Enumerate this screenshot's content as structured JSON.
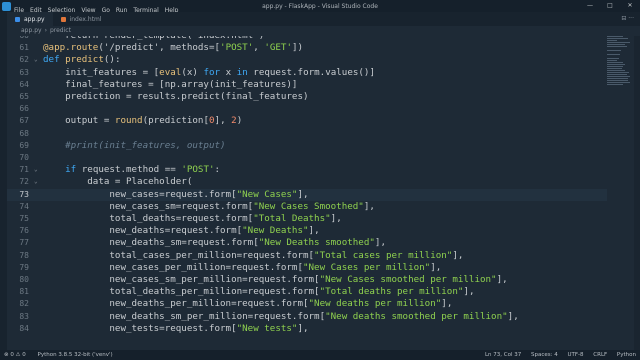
{
  "titlebar": {
    "menu": [
      "File",
      "Edit",
      "Selection",
      "View",
      "Go",
      "Run",
      "Terminal",
      "Help"
    ],
    "title": "app.py - FlaskApp - Visual Studio Code",
    "min": "—",
    "max": "□",
    "close": "✕"
  },
  "tabs": [
    {
      "label": "app.py",
      "color": "#3b8eea"
    },
    {
      "label": "index.html",
      "color": "#e0763a"
    }
  ],
  "tab_actions": "⊟ ···",
  "breadcrumb": {
    "file": "app.py",
    "symbol": "predict"
  },
  "code": {
    "lines": [
      {
        "n": "60",
        "tokens": [
          [
            "    return render_template('index.html')",
            ""
          ]
        ]
      },
      {
        "n": "61",
        "tokens": [
          [
            "@app.route",
            "dec"
          ],
          [
            "('/predict', methods=[",
            ""
          ],
          [
            "'POST'",
            "str"
          ],
          [
            ", ",
            ""
          ],
          [
            "'GET'",
            "str"
          ],
          [
            "])",
            ""
          ]
        ]
      },
      {
        "n": "62",
        "tokens": [
          [
            "def ",
            "kw"
          ],
          [
            "predict",
            "fn"
          ],
          [
            "():",
            ""
          ]
        ]
      },
      {
        "n": "63",
        "tokens": [
          [
            "    init_features = [",
            ""
          ],
          [
            "eval",
            "fn"
          ],
          [
            "(x) ",
            ""
          ],
          [
            "for",
            "kw"
          ],
          [
            " x ",
            ""
          ],
          [
            "in",
            "kw"
          ],
          [
            " request.form.values()]",
            ""
          ]
        ]
      },
      {
        "n": "64",
        "tokens": [
          [
            "    final_features = [np.array(init_features)]",
            ""
          ]
        ]
      },
      {
        "n": "65",
        "tokens": [
          [
            "    prediction = results.predict(final_features)",
            ""
          ]
        ]
      },
      {
        "n": "66",
        "tokens": [
          [
            "",
            ""
          ]
        ]
      },
      {
        "n": "67",
        "tokens": [
          [
            "    output = ",
            ""
          ],
          [
            "round",
            "fn"
          ],
          [
            "(prediction[",
            ""
          ],
          [
            "0",
            "num"
          ],
          [
            "], ",
            ""
          ],
          [
            "2",
            "num"
          ],
          [
            ")",
            ""
          ]
        ]
      },
      {
        "n": "68",
        "tokens": [
          [
            "",
            ""
          ]
        ]
      },
      {
        "n": "69",
        "tokens": [
          [
            "    #print(init_features, output)",
            "cm"
          ]
        ]
      },
      {
        "n": "70",
        "tokens": [
          [
            "",
            ""
          ]
        ]
      },
      {
        "n": "71",
        "tokens": [
          [
            "    ",
            ""
          ],
          [
            "if",
            "kw"
          ],
          [
            " request.method == ",
            ""
          ],
          [
            "'POST'",
            "str"
          ],
          [
            ":",
            ""
          ]
        ]
      },
      {
        "n": "72",
        "tokens": [
          [
            "        data = Placeholder(",
            ""
          ]
        ]
      },
      {
        "n": "73",
        "tokens": [
          [
            "            new_cases=request.form[",
            ""
          ],
          [
            "\"New Cases\"",
            "str"
          ],
          [
            "],",
            ""
          ]
        ]
      },
      {
        "n": "74",
        "tokens": [
          [
            "            new_cases_sm=request.form[",
            ""
          ],
          [
            "\"New Cases Smoothed\"",
            "str"
          ],
          [
            "],",
            ""
          ]
        ]
      },
      {
        "n": "75",
        "tokens": [
          [
            "            total_deaths=request.form[",
            ""
          ],
          [
            "\"Total Deaths\"",
            "str"
          ],
          [
            "],",
            ""
          ]
        ]
      },
      {
        "n": "76",
        "tokens": [
          [
            "            new_deaths=request.form[",
            ""
          ],
          [
            "\"New Deaths\"",
            "str"
          ],
          [
            "],",
            ""
          ]
        ]
      },
      {
        "n": "77",
        "tokens": [
          [
            "            new_deaths_sm=request.form[",
            ""
          ],
          [
            "\"New Deaths smoothed\"",
            "str"
          ],
          [
            "],",
            ""
          ]
        ]
      },
      {
        "n": "78",
        "tokens": [
          [
            "            total_cases_per_million=request.form[",
            ""
          ],
          [
            "\"Total cases per million\"",
            "str"
          ],
          [
            "],",
            ""
          ]
        ]
      },
      {
        "n": "79",
        "tokens": [
          [
            "            new_cases_per_million=request.form[",
            ""
          ],
          [
            "\"New Cases per million\"",
            "str"
          ],
          [
            "],",
            ""
          ]
        ]
      },
      {
        "n": "80",
        "tokens": [
          [
            "            new_cases_sm_per_million=request.form[",
            ""
          ],
          [
            "\"New Cases smoothed per million\"",
            "str"
          ],
          [
            "],",
            ""
          ]
        ]
      },
      {
        "n": "81",
        "tokens": [
          [
            "            total_deaths_per_million=request.form[",
            ""
          ],
          [
            "\"Total deaths per million\"",
            "str"
          ],
          [
            "],",
            ""
          ]
        ]
      },
      {
        "n": "82",
        "tokens": [
          [
            "            new_deaths_per_million=request.form[",
            ""
          ],
          [
            "\"New deaths per million\"",
            "str"
          ],
          [
            "],",
            ""
          ]
        ]
      },
      {
        "n": "83",
        "tokens": [
          [
            "            new_deaths_sm_per_million=request.form[",
            ""
          ],
          [
            "\"New deaths smoothed per million\"",
            "str"
          ],
          [
            "],",
            ""
          ]
        ]
      },
      {
        "n": "84",
        "tokens": [
          [
            "            new_tests=request.form[",
            ""
          ],
          [
            "\"New tests\"",
            "str"
          ],
          [
            "],",
            ""
          ]
        ]
      }
    ],
    "current_line": "73"
  },
  "statusbar": {
    "left": [
      "⊗ 0 ⚠ 0",
      "Python 3.8.5 32-bit ('venv')"
    ],
    "right": [
      "Ln 73, Col 37",
      "Spaces: 4",
      "UTF-8",
      "CRLF",
      "Python"
    ]
  }
}
